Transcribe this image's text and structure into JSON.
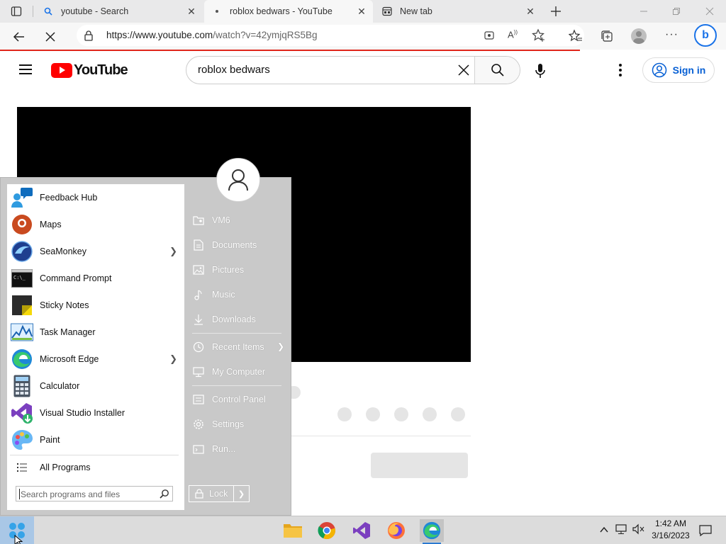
{
  "browser": {
    "tabs": [
      {
        "title": "youtube - Search",
        "icon": "search-icon",
        "active": false
      },
      {
        "title": "roblox bedwars - YouTube",
        "icon": "loading-dot-icon",
        "active": true
      },
      {
        "title": "New tab",
        "icon": "new-tab-page-icon",
        "active": false
      }
    ],
    "url": "https://www.youtube.com/watch?v=42ymjqRS5Bg",
    "url_host": "https://www.youtube.com",
    "url_path": "/watch?v=42ymjqRS5Bg"
  },
  "youtube": {
    "logo_text": "YouTube",
    "search_value": "roblox bedwars",
    "signin_label": "Sign in"
  },
  "start_menu": {
    "apps": [
      {
        "label": "Feedback Hub",
        "icon": "feedback-hub-icon",
        "submenu": false
      },
      {
        "label": "Maps",
        "icon": "maps-icon",
        "submenu": false
      },
      {
        "label": "SeaMonkey",
        "icon": "seamonkey-icon",
        "submenu": true
      },
      {
        "label": "Command Prompt",
        "icon": "command-prompt-icon",
        "submenu": false
      },
      {
        "label": "Sticky Notes",
        "icon": "sticky-notes-icon",
        "submenu": false
      },
      {
        "label": "Task Manager",
        "icon": "task-manager-icon",
        "submenu": false
      },
      {
        "label": "Microsoft Edge",
        "icon": "edge-icon",
        "submenu": true
      },
      {
        "label": "Calculator",
        "icon": "calculator-icon",
        "submenu": false
      },
      {
        "label": "Visual Studio Installer",
        "icon": "visual-studio-installer-icon",
        "submenu": false
      },
      {
        "label": "Paint",
        "icon": "paint-icon",
        "submenu": false
      }
    ],
    "all_programs": "All Programs",
    "search_placeholder": "Search programs and files",
    "right_links": [
      {
        "label": "VM6",
        "icon": "user-folder-icon"
      },
      {
        "label": "Documents",
        "icon": "documents-icon"
      },
      {
        "label": "Pictures",
        "icon": "pictures-icon"
      },
      {
        "label": "Music",
        "icon": "music-icon"
      },
      {
        "label": "Downloads",
        "icon": "downloads-icon"
      },
      {
        "label": "Recent Items",
        "icon": "recent-items-icon"
      },
      {
        "label": "My Computer",
        "icon": "computer-icon"
      },
      {
        "label": "Control Panel",
        "icon": "control-panel-icon"
      },
      {
        "label": "Settings",
        "icon": "settings-icon"
      },
      {
        "label": "Run...",
        "icon": "run-icon"
      }
    ],
    "lock_label": "Lock"
  },
  "taskbar": {
    "time": "1:42 AM",
    "date": "3/16/2023",
    "pinned": [
      "file-explorer-icon",
      "chrome-icon",
      "visual-studio-icon",
      "firefox-icon",
      "edge-icon"
    ]
  },
  "colors": {
    "youtube_red": "#ff0000",
    "signin_blue": "#065fd4",
    "progress_red": "#e0261b"
  }
}
